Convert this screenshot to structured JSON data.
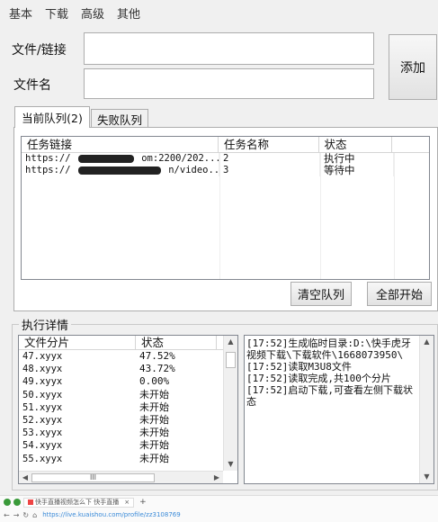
{
  "menu": [
    "基本",
    "下载",
    "高级",
    "其他"
  ],
  "form": {
    "file_link_label": "文件/链接",
    "file_name_label": "文件名",
    "file_link_value": "",
    "file_name_value": "",
    "add_button": "添加"
  },
  "tabs": [
    {
      "label": "当前队列(2)"
    },
    {
      "label": "失败队列"
    }
  ],
  "queue": {
    "columns": [
      "任务链接",
      "任务名称",
      "状态"
    ],
    "rows": [
      {
        "link": "https://",
        "link_tail": "om:2200/202...",
        "name": "2",
        "status": "执行中"
      },
      {
        "link": "https://",
        "link_tail": "n/video...",
        "name": "3",
        "status": "等待中"
      }
    ],
    "clear_button": "清空队列",
    "start_all_button": "全部开始"
  },
  "details": {
    "group_title": "执行详情",
    "columns": [
      "文件分片",
      "状态"
    ],
    "rows": [
      {
        "file": "47.xyyx",
        "status": "47.52%"
      },
      {
        "file": "48.xyyx",
        "status": "43.72%"
      },
      {
        "file": "49.xyyx",
        "status": "0.00%"
      },
      {
        "file": "50.xyyx",
        "status": "未开始"
      },
      {
        "file": "51.xyyx",
        "status": "未开始"
      },
      {
        "file": "52.xyyx",
        "status": "未开始"
      },
      {
        "file": "53.xyyx",
        "status": "未开始"
      },
      {
        "file": "54.xyyx",
        "status": "未开始"
      },
      {
        "file": "55.xyyx",
        "status": "未开始"
      }
    ],
    "hscroll_grip": "III",
    "log": [
      "[17:52]生成临时目录:D:\\快手虎牙视频下载\\下载软件\\1668073950\\",
      "[17:52]读取M3U8文件",
      "[17:52]读取完成,共100个分片",
      "[17:52]启动下载,可查看左侧下载状态"
    ]
  },
  "browser": {
    "tab_title": "快手直播视频怎么下 快手直播",
    "new_tab": "+",
    "close_tab": "×",
    "url": "https://live.kuaishou.com/profile/zz3108769"
  }
}
